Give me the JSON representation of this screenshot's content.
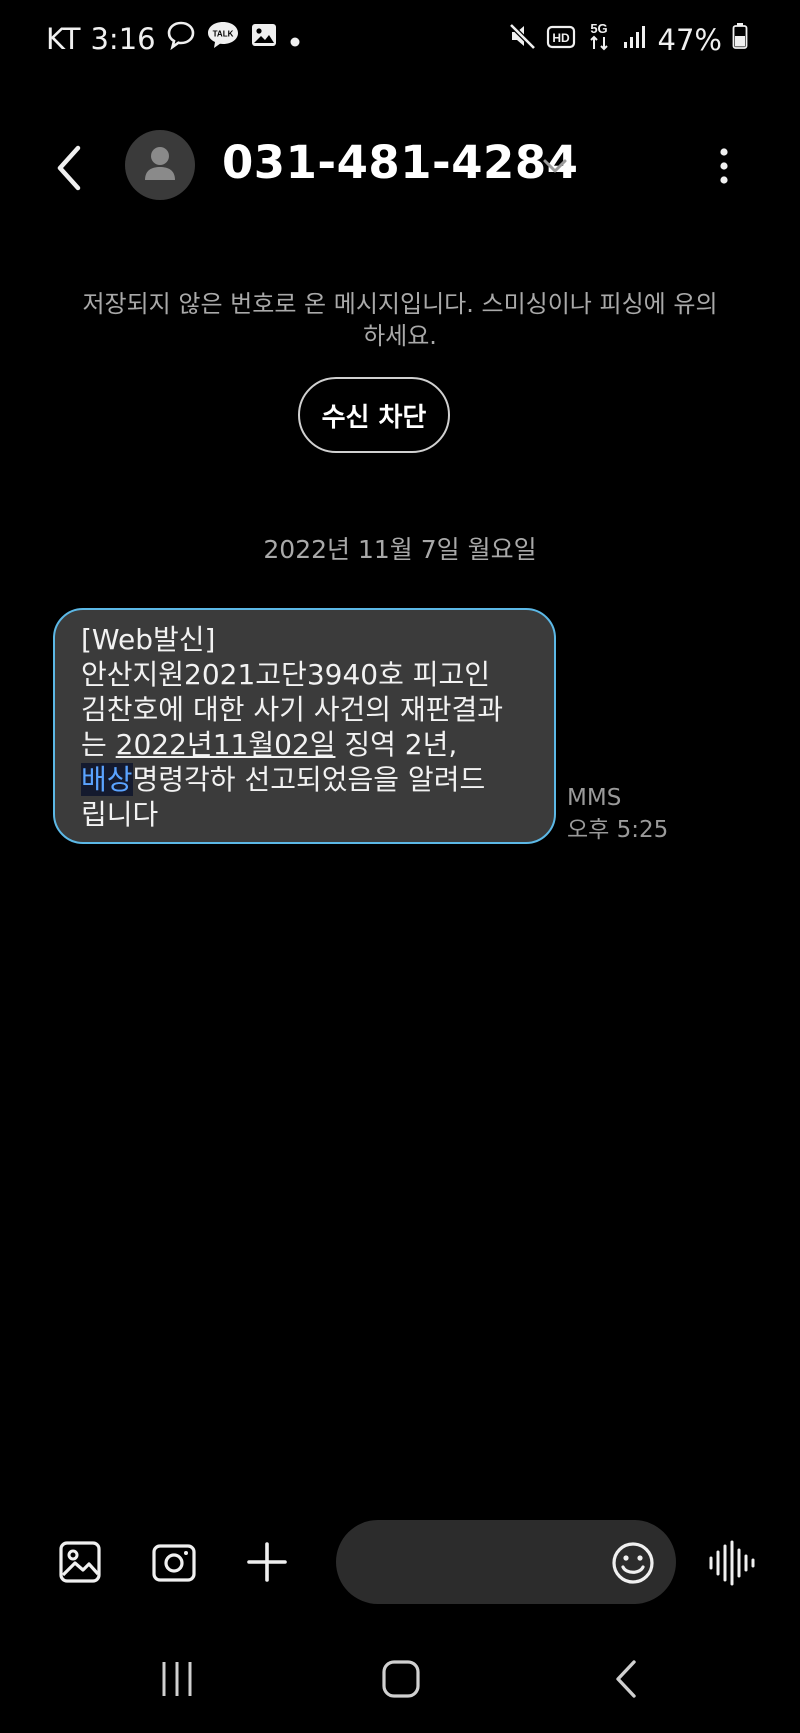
{
  "status_bar": {
    "carrier": "KT",
    "time": "3:16",
    "talk_badge": "TALK",
    "hd_badge": "HD",
    "network": "5G",
    "battery": "47%"
  },
  "header": {
    "contact_number": "031-481-4284"
  },
  "notice": {
    "warning_text": "저장되지 않은 번호로 온 메시지입니다. 스미싱이나 피싱에 유의하세요.",
    "block_button": "수신 차단"
  },
  "conversation": {
    "date_divider": "2022년 11월 7일 월요일",
    "message": {
      "line1": "[Web발신]",
      "line2": "안산지원2021고단3940호 피고인",
      "line3": "김찬호에 대한 사기 사건의 재판결과",
      "line4_pre": "는 ",
      "line4_date": "2022년11월02일",
      "line4_post": " 징역 2년,",
      "line5_selected": "배상",
      "line5_rest": "명령각하 선고되었음을 알려드",
      "line6": "립니다"
    },
    "message_type": "MMS",
    "message_time": "오후 5:25"
  },
  "colors": {
    "bubble_border": "#5cb8e6",
    "bubble_bg": "#3b3b3b",
    "selection_text": "#5aa3ff"
  }
}
